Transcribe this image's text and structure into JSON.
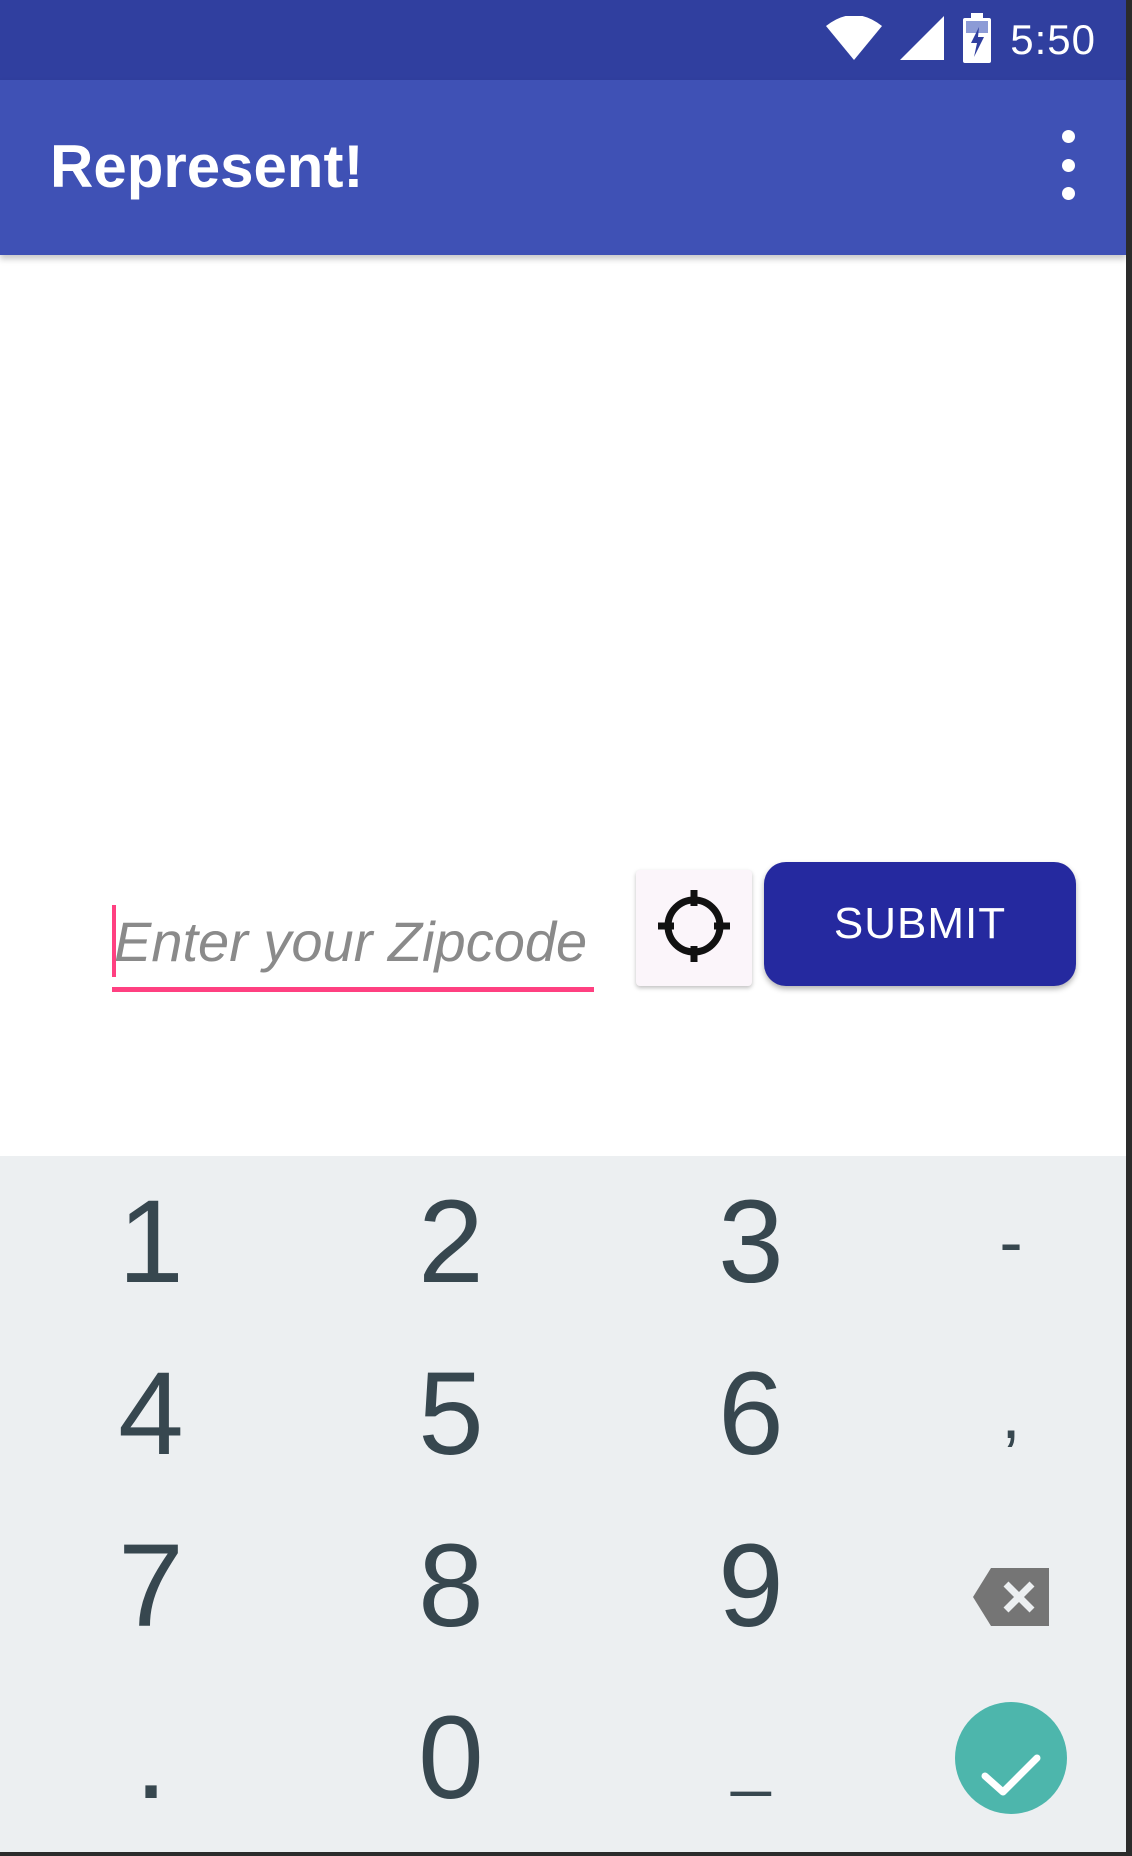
{
  "status_bar": {
    "time": "5:50",
    "icons": [
      "wifi-icon",
      "cell-signal-icon",
      "battery-charging-icon"
    ]
  },
  "app_bar": {
    "title": "Represent!",
    "menu_icon": "more-vert-icon"
  },
  "zip_input": {
    "placeholder": "Enter your Zipcode",
    "value": ""
  },
  "locate_button": {
    "icon": "my-location-icon"
  },
  "submit_button": {
    "label": "SUBMIT"
  },
  "keyboard": {
    "rows": [
      [
        "1",
        "2",
        "3",
        "-"
      ],
      [
        "4",
        "5",
        "6",
        ","
      ],
      [
        "7",
        "8",
        "9",
        "backspace"
      ],
      [
        ".",
        "0",
        "_",
        "done"
      ]
    ]
  },
  "colors": {
    "status_bar": "#303f9f",
    "app_bar": "#3f51b5",
    "accent": "#ff4081",
    "submit": "#25299f",
    "keyboard_bg": "#eceff1",
    "key_text": "#37474f",
    "done_key": "#4db6ac"
  }
}
